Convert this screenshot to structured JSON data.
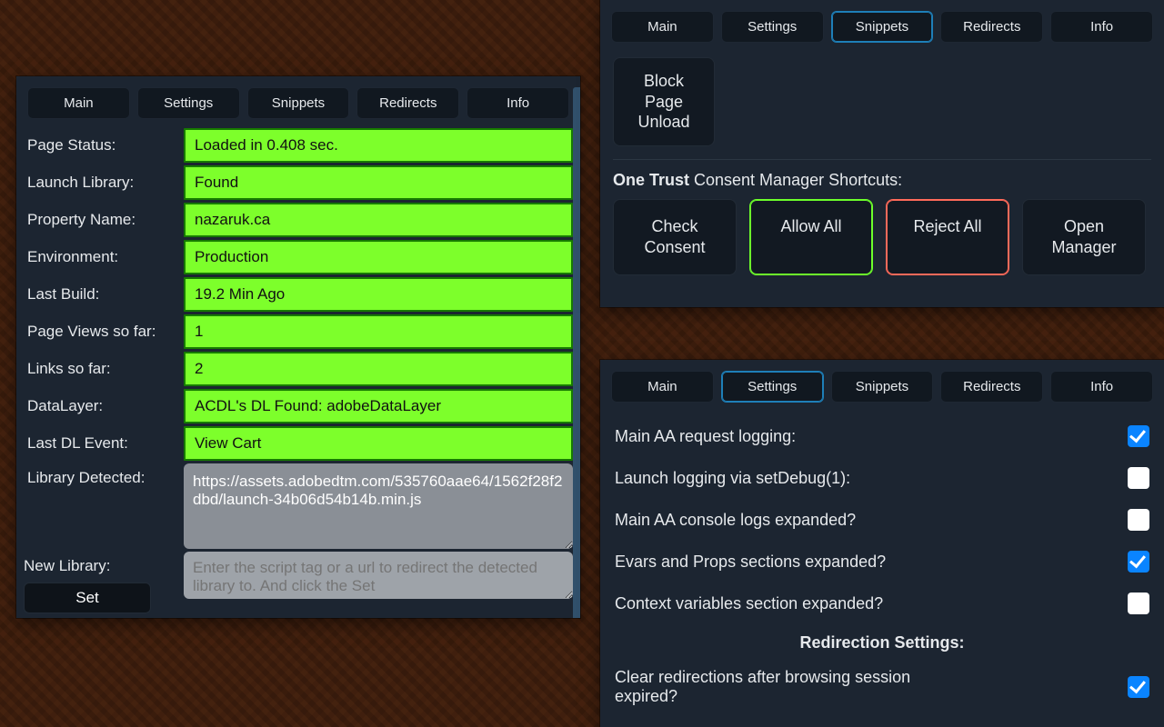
{
  "tabs": {
    "main": "Main",
    "settings": "Settings",
    "snippets": "Snippets",
    "redirects": "Redirects",
    "info": "Info"
  },
  "main": {
    "page_status_label": "Page Status:",
    "page_status_value": "Loaded in 0.408 sec.",
    "launch_library_label": "Launch Library:",
    "launch_library_value": "Found",
    "property_name_label": "Property Name:",
    "property_name_value": "nazaruk.ca",
    "environment_label": "Environment:",
    "environment_value": "Production",
    "last_build_label": "Last Build:",
    "last_build_value": "19.2 Min Ago",
    "page_views_label": "Page Views so far:",
    "page_views_value": "1",
    "links_label": "Links so far:",
    "links_value": "2",
    "datalayer_label": "DataLayer:",
    "datalayer_value": "ACDL's DL Found: adobeDataLayer",
    "last_dl_event_label": "Last DL Event:",
    "last_dl_event_value": "View Cart",
    "library_detected_label": "Library Detected:",
    "library_detected_value": "https://assets.adobedtm.com/535760aae64/1562f28f2dbd/launch-34b06d54b14b.min.js",
    "new_library_label": "New Library:",
    "new_library_placeholder": "Enter the script tag or a url to redirect the detected library to. And click the Set",
    "set_button": "Set"
  },
  "snippets": {
    "block_page_unload": "Block Page Unload",
    "ot_title_bold": "One Trust",
    "ot_title_rest": " Consent Manager Shortcuts:",
    "check_consent": "Check Consent",
    "allow_all": "Allow All",
    "reject_all": "Reject All",
    "open_manager": "Open Manager"
  },
  "settings": {
    "items": [
      {
        "label": "Main AA request logging:",
        "checked": true
      },
      {
        "label": "Launch logging via setDebug(1):",
        "checked": false
      },
      {
        "label": "Main AA console logs expanded?",
        "checked": false
      },
      {
        "label": "Evars and Props sections expanded?",
        "checked": true
      },
      {
        "label": "Context variables section expanded?",
        "checked": false
      }
    ],
    "redirection_heading": "Redirection Settings:",
    "clear_redirections_label": "Clear redirections after browsing session expired?",
    "clear_redirections_checked": true
  }
}
